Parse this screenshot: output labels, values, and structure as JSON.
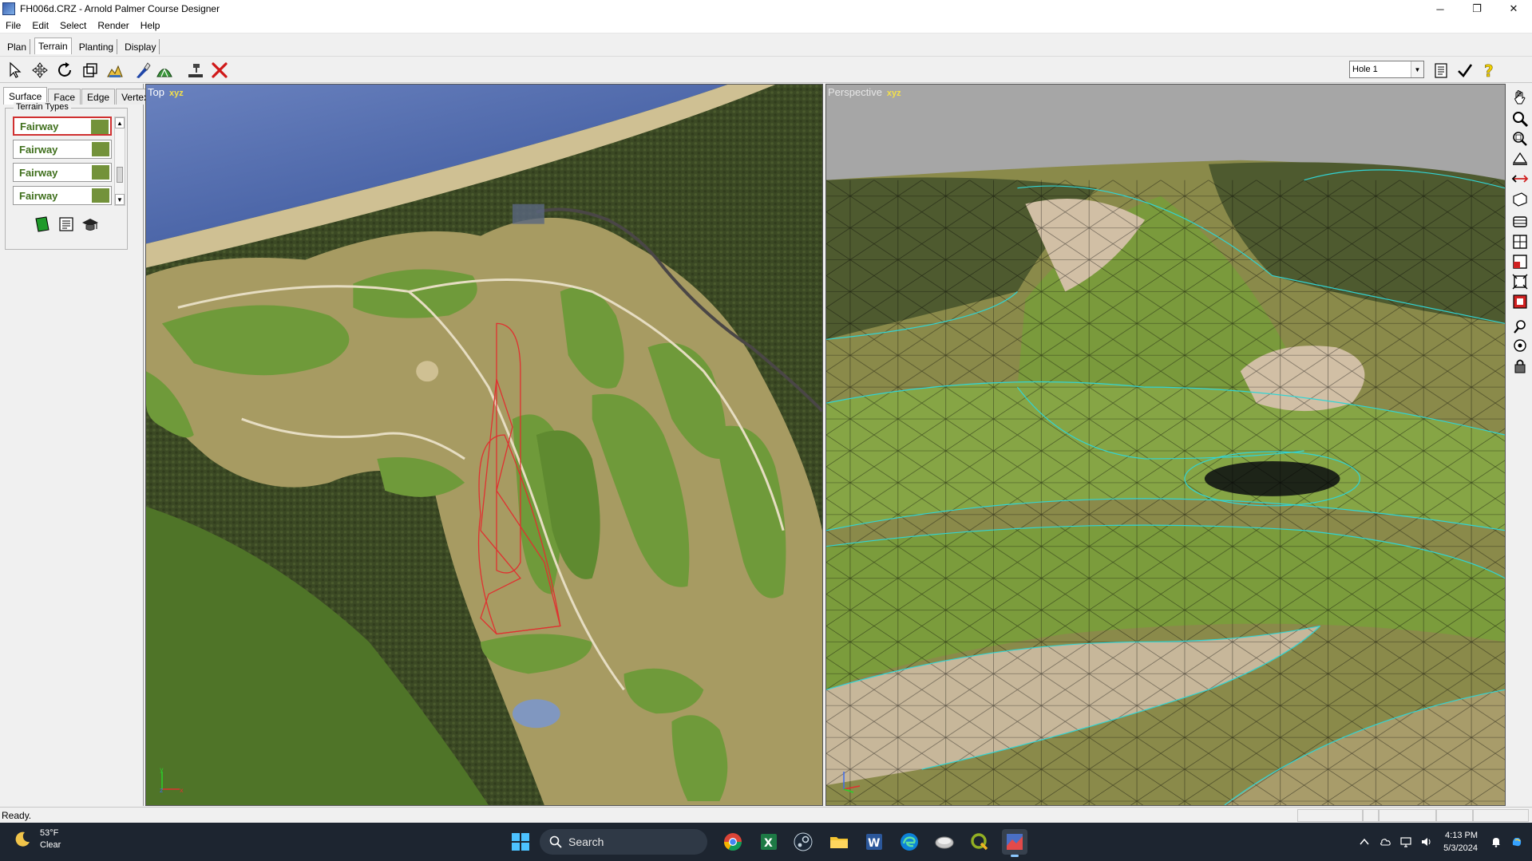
{
  "window": {
    "title": "FH006d.CRZ - Arnold Palmer Course Designer"
  },
  "menu": [
    "File",
    "Edit",
    "Select",
    "Render",
    "Help"
  ],
  "mode_tabs": [
    "Plan",
    "Terrain",
    "Planting",
    "Display"
  ],
  "hole_select": {
    "value": "Hole 1"
  },
  "sub_tabs": [
    "Surface",
    "Face",
    "Edge",
    "Vertex"
  ],
  "terrain": {
    "legend": "Terrain Types",
    "items": [
      {
        "label": "Fairway",
        "color": "#73923a"
      },
      {
        "label": "Fairway",
        "color": "#73923a"
      },
      {
        "label": "Fairway",
        "color": "#73923a"
      },
      {
        "label": "Fairway",
        "color": "#73923a"
      }
    ]
  },
  "views": {
    "top": {
      "label": "Top",
      "axes": "xyz"
    },
    "perspective": {
      "label": "Perspective",
      "axes": "xyz"
    }
  },
  "status": {
    "text": "Ready."
  },
  "taskbar": {
    "weather": {
      "temp": "53°F",
      "condition": "Clear"
    },
    "search_label": "Search",
    "time": "4:13 PM",
    "date": "5/3/2024"
  },
  "colors": {
    "water": "#3e5aa0",
    "sand": "#d6c9a1",
    "rough": "#a79b62",
    "fairway": "#6f9a3a",
    "forest": "#3d4a26",
    "wire": "#31d4d4"
  }
}
